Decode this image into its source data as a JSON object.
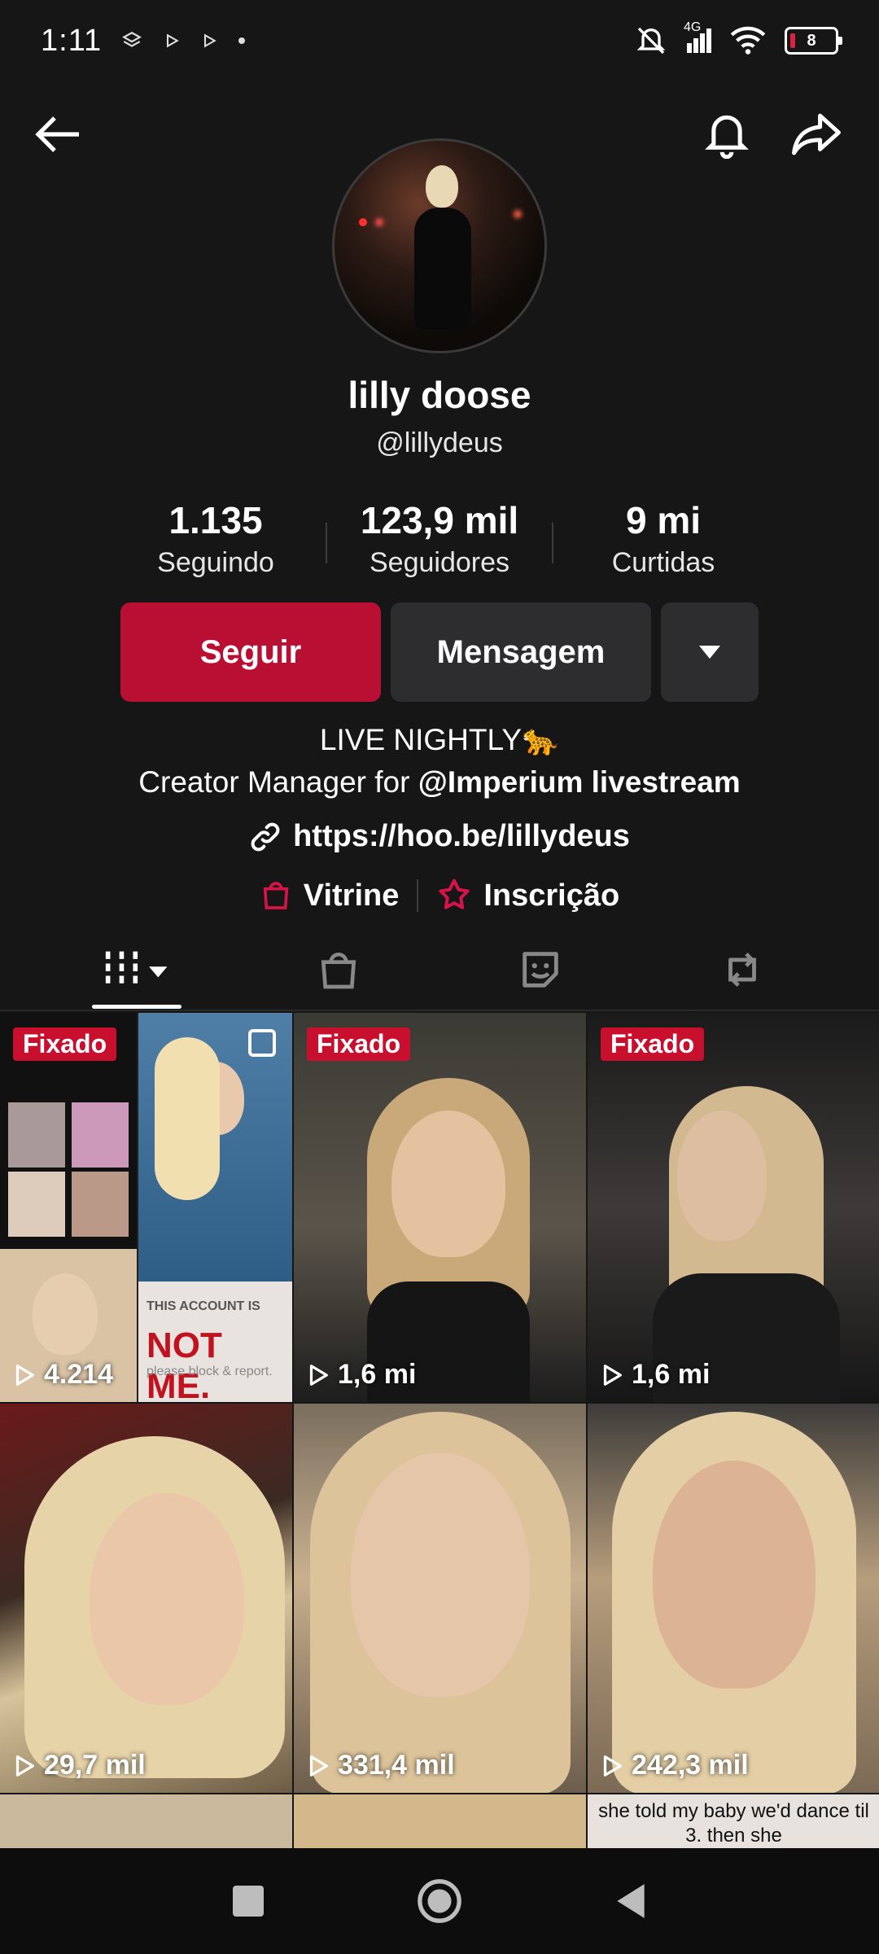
{
  "status_bar": {
    "time": "1:11",
    "network": "4G",
    "battery": "8"
  },
  "profile": {
    "name": "lilly doose",
    "handle": "@lillydeus"
  },
  "stats": [
    {
      "value": "1.135",
      "label": "Seguindo"
    },
    {
      "value": "123,9 mil",
      "label": "Seguidores"
    },
    {
      "value": "9 mi",
      "label": "Curtidas"
    }
  ],
  "actions": {
    "follow": "Seguir",
    "message": "Mensagem"
  },
  "bio": {
    "line1": "LIVE NIGHTLY🐆",
    "line2_prefix": "Creator Manager for ",
    "line2_bold": "@Imperium livestream",
    "link": "https://hoo.be/lillydeus"
  },
  "extras": {
    "showcase": "Vitrine",
    "subscription": "Inscrição"
  },
  "videos": [
    {
      "pinned": "Fixado",
      "views": "4.214"
    },
    {
      "pinned": "Fixado",
      "views": "1,6 mi"
    },
    {
      "pinned": "Fixado",
      "views": "1,6 mi"
    },
    {
      "views": "29,7 mil"
    },
    {
      "views": "331,4 mil"
    },
    {
      "views": "242,3 mil"
    }
  ],
  "tile1_text": {
    "line1": "THIS ACCOUNT IS",
    "line2": "NOT ME.",
    "line3": "please block & report."
  },
  "tile9_caption": "she told my baby we'd dance til 3. then she",
  "colors": {
    "accent": "#b80f33",
    "pinned": "#c8102e",
    "background": "#161616"
  }
}
